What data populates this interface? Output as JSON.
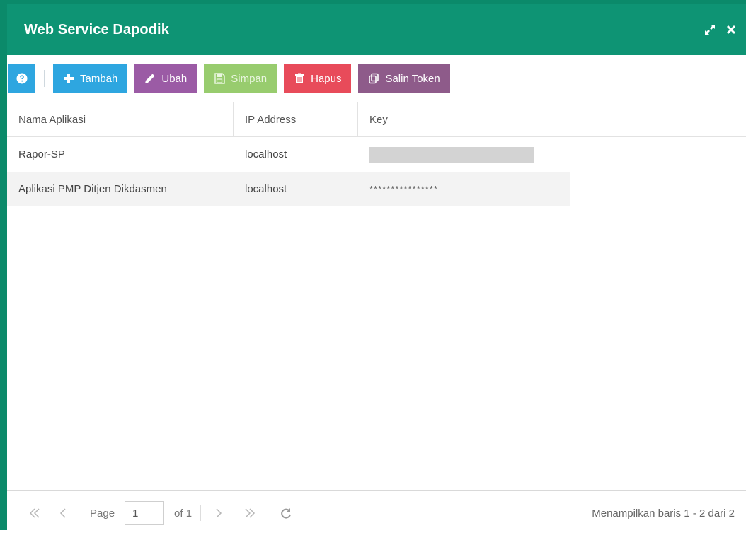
{
  "window": {
    "title": "Web Service Dapodik"
  },
  "toolbar": {
    "buttons": [
      {
        "name": "help",
        "label": ""
      },
      {
        "name": "tambah",
        "label": "Tambah"
      },
      {
        "name": "ubah",
        "label": "Ubah"
      },
      {
        "name": "simpan",
        "label": "Simpan"
      },
      {
        "name": "hapus",
        "label": "Hapus"
      },
      {
        "name": "salin-token",
        "label": "Salin Token"
      }
    ]
  },
  "grid": {
    "columns": [
      "Nama Aplikasi",
      "IP Address",
      "Key"
    ],
    "rows": [
      {
        "nama_aplikasi": "Rapor-SP",
        "ip_address": "localhost",
        "key": ""
      },
      {
        "nama_aplikasi": "Aplikasi PMP Ditjen Dikdasmen",
        "ip_address": "localhost",
        "key": "****************"
      }
    ]
  },
  "pager": {
    "page_label": "Page",
    "page_value": "1",
    "of_label": "of 1",
    "summary": "Menampilkan baris 1 - 2 dari 2"
  },
  "colors": {
    "titlebar": "#0e9474",
    "help": "#2ea6e0",
    "tambah": "#2ea6e0",
    "ubah": "#9b5ba5",
    "simpan": "#98cc6e",
    "hapus": "#e84b5a",
    "salin": "#8e5b8a"
  },
  "icons": {
    "help": "question-circle-icon",
    "tambah": "plus-icon",
    "ubah": "pencil-icon",
    "simpan": "save-icon",
    "hapus": "trash-icon",
    "salin": "copy-icon",
    "maximize": "expand-icon",
    "close": "close-icon",
    "first": "double-chevron-left-icon",
    "prev": "chevron-left-icon",
    "next": "chevron-right-icon",
    "last": "double-chevron-right-icon",
    "refresh": "refresh-icon"
  }
}
